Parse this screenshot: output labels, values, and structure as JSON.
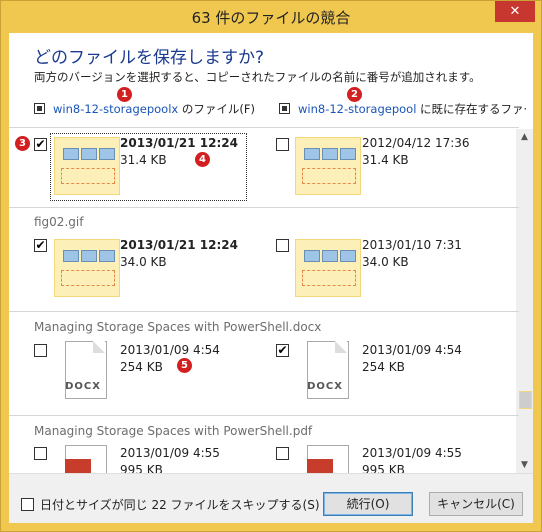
{
  "window": {
    "title": "63 件のファイルの競合",
    "close_label": "✕"
  },
  "heading": "どのファイルを保存しますか?",
  "subheading": "両方のバージョンを選択すると、コピーされたファイルの名前に番号が追加されます。",
  "columns": {
    "left": {
      "link": "win8-12-storagepoolx",
      "suffix": " のファイル(F)"
    },
    "right": {
      "link": "win8-12-storagepool",
      "suffix": " に既に存在するファ·"
    }
  },
  "badges": [
    "1",
    "2",
    "3",
    "4",
    "5"
  ],
  "groups": [
    {
      "name": "",
      "left": {
        "date": "2013/01/21 12:24",
        "size": "31.4 KB",
        "checked": "✔"
      },
      "right": {
        "date": "2012/04/12 17:36",
        "size": "31.4 KB",
        "checked": ""
      }
    },
    {
      "name": "fig02.gif",
      "left": {
        "date": "2013/01/21 12:24",
        "size": "34.0 KB",
        "checked": "✔"
      },
      "right": {
        "date": "2013/01/10 7:31",
        "size": "34.0 KB",
        "checked": ""
      }
    },
    {
      "name": "Managing Storage Spaces with PowerShell.docx",
      "icon_label": "DOCX",
      "left": {
        "date": "2013/01/09 4:54",
        "size": "254 KB",
        "checked": ""
      },
      "right": {
        "date": "2013/01/09 4:54",
        "size": "254 KB",
        "checked": "✔"
      }
    },
    {
      "name": "Managing Storage Spaces with PowerShell.pdf",
      "left": {
        "date": "2013/01/09 4:55",
        "size": "995 KB",
        "checked": ""
      },
      "right": {
        "date": "2013/01/09 4:55",
        "size": "995 KB",
        "checked": ""
      }
    }
  ],
  "footer": {
    "skip_label": "日付とサイズが同じ 22 ファイルをスキップする(S)",
    "continue_label": "続行(O)",
    "cancel_label": "キャンセル(C)"
  },
  "colors": {
    "accent": "#1a55b8",
    "badge": "#d22020",
    "titlebar": "#f0c850"
  },
  "icons": [
    "close-icon",
    "checkbox-icon",
    "image-thumbnail-icon",
    "docx-file-icon",
    "pdf-file-icon",
    "scroll-up-icon",
    "scroll-down-icon"
  ]
}
